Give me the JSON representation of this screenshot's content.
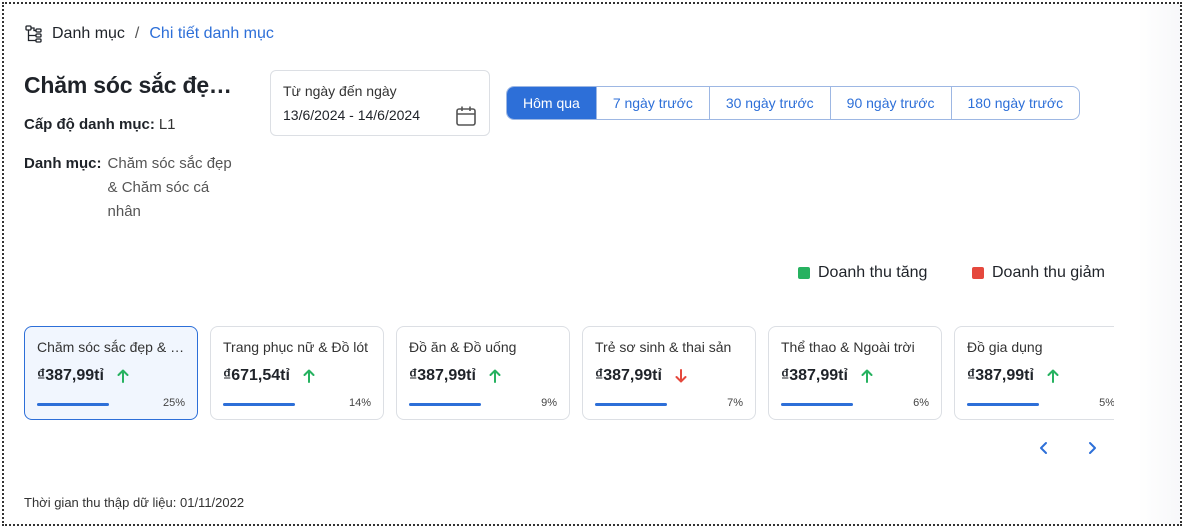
{
  "breadcrumb": {
    "icon": "category-tree-icon",
    "root": "Danh mục",
    "separator": "/",
    "current": "Chi tiết danh mục"
  },
  "category": {
    "title": "Chăm sóc sắc đẹp & Chăm sóc cá nhân",
    "level_label": "Cấp độ danh mục:",
    "level_value": "L1",
    "category_label": "Danh mục:",
    "category_value": "Chăm sóc sắc đẹp & Chăm sóc cá nhân"
  },
  "date_range": {
    "label": "Từ ngày đến ngày",
    "value": "13/6/2024 - 14/6/2024",
    "icon": "calendar-icon"
  },
  "period_tabs": [
    {
      "label": "Hôm qua",
      "active": true
    },
    {
      "label": "7 ngày trước",
      "active": false
    },
    {
      "label": "30 ngày trước",
      "active": false
    },
    {
      "label": "90 ngày trước",
      "active": false
    },
    {
      "label": "180 ngày trước",
      "active": false
    }
  ],
  "legend": {
    "increase_label": "Doanh thu tăng",
    "decrease_label": "Doanh thu giảm",
    "increase_color": "#27b260",
    "decrease_color": "#e5483d"
  },
  "cards": [
    {
      "name": "Chăm sóc sắc đẹp & Chăm sóc cá nhân",
      "value": "₫387,99tỉ",
      "trend": "up",
      "share": 0.25,
      "percent": "25%",
      "active": true
    },
    {
      "name": "Trang phục nữ & Đồ lót",
      "value": "₫671,54tỉ",
      "trend": "up",
      "share": 0.14,
      "percent": "14%",
      "active": false
    },
    {
      "name": "Đồ ăn & Đồ uống",
      "value": "₫387,99tỉ",
      "trend": "up",
      "share": 0.09,
      "percent": "9%",
      "active": false
    },
    {
      "name": "Trẻ sơ sinh & thai sản",
      "value": "₫387,99tỉ",
      "trend": "down",
      "share": 0.07,
      "percent": "7%",
      "active": false
    },
    {
      "name": "Thể thao & Ngoài trời",
      "value": "₫387,99tỉ",
      "trend": "up",
      "share": 0.06,
      "percent": "6%",
      "active": false
    },
    {
      "name": "Đồ gia dụng",
      "value": "₫387,99tỉ",
      "trend": "up",
      "share": 0.05,
      "percent": "5%",
      "active": false
    }
  ],
  "pager": {
    "prev_icon": "chevron-left-icon",
    "next_icon": "chevron-right-icon"
  },
  "footer": {
    "text": "Thời gian thu thập dữ liệu: 01/11/2022"
  },
  "colors": {
    "accent": "#2d6fd8",
    "up": "#27b260",
    "down": "#e5483d"
  }
}
